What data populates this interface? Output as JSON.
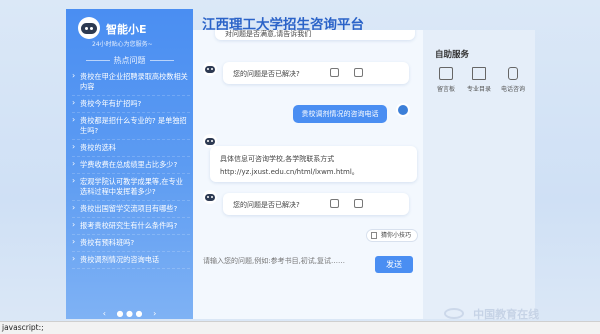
{
  "sidebar": {
    "bot_name": "智能小E",
    "bot_subtitle": "24小时贴心为您服务~",
    "hot_title": "热点问题",
    "questions": [
      "贵校在甲企业招聘录取高校数相关内容",
      "贵校今年有扩招吗?",
      "贵校都是招什么专业的? 是单独招生吗?",
      "贵校的选科",
      "学费收费在总成绩里占比多少?",
      "宏观学院认可教学成果等,在专业选科过程中发挥着多少?",
      "贵校出国留学交流项目有哪些?",
      "报考贵校研究生有什么条件吗?",
      "贵校有预科班吗?",
      "贵校调剂情况的咨询电话"
    ],
    "pager": {
      "prev": "‹",
      "dots": "● ● ●",
      "next": "›"
    }
  },
  "header": {
    "title": "江西理工大学招生咨询平台"
  },
  "chat": {
    "top_partial": "对问题是否满意,请告诉我们",
    "bot_msg_1": "您的问题是否已解决?",
    "user_msg": "贵校调剂情况的咨询电话",
    "answer_line_1": "具体信息可咨询学校,各学院联系方式",
    "answer_line_2": "http://yz.jxust.edu.cn/html/lxwm.html。",
    "bot_msg_2": "您的问题是否已解决?",
    "related_label": "猜你小技巧"
  },
  "input": {
    "placeholder": "请输入您的问题,例如:参考书目,初试,复试……",
    "send_label": "发送"
  },
  "services": {
    "title": "自助服务",
    "items": [
      {
        "label": "留言板",
        "icon": "message-board-icon"
      },
      {
        "label": "专业目录",
        "icon": "book-icon"
      },
      {
        "label": "电话咨询",
        "icon": "phone-icon"
      }
    ]
  },
  "footer": {
    "logo_text": "中国教育在线"
  },
  "status_bar": {
    "text": "javascript:;"
  },
  "colors": {
    "accent": "#4a8ef2",
    "title": "#2b63c8"
  }
}
